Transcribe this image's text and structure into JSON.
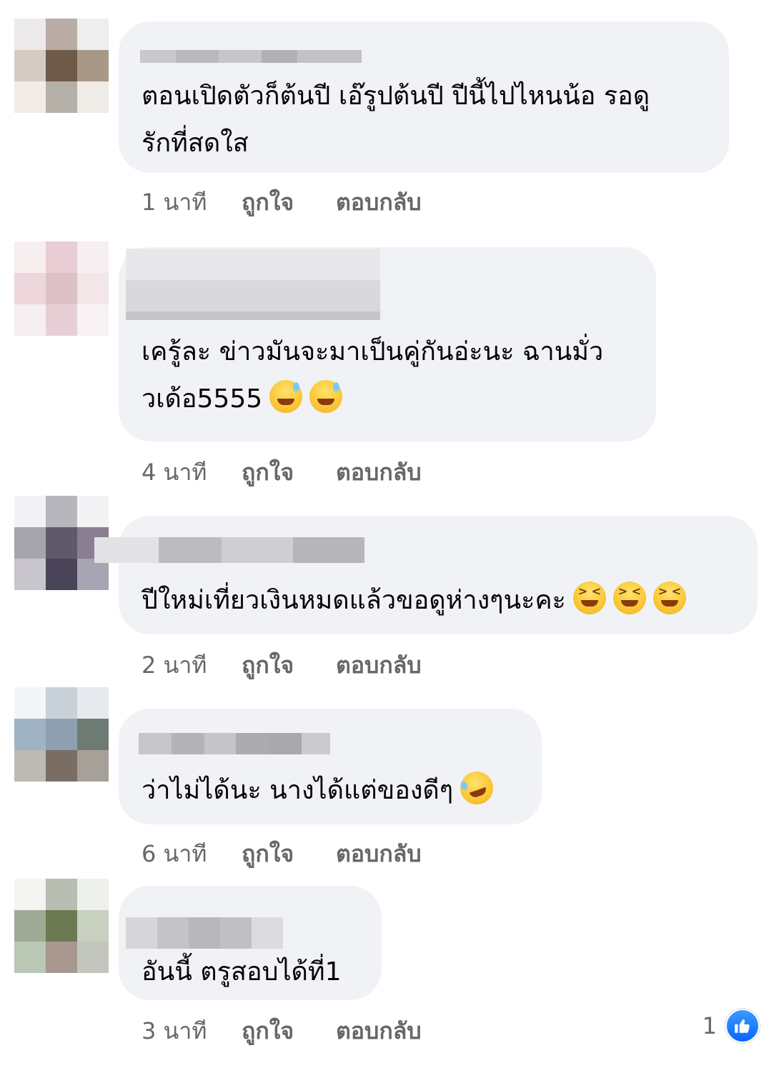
{
  "colors": {
    "bubble_bg": "#f0f2f5",
    "text": "#050505",
    "meta_text": "#65676b",
    "like_blue": "#0866ff"
  },
  "comments": [
    {
      "text": "ตอนเปิดตัวก็ต้นปี เอ๊รูปต้นปี ปีนี้ไปไหนน้อ รอดู\nรักที่สดใส",
      "emojis": [],
      "time": "1 นาที",
      "like_label": "ถูกใจ",
      "reply_label": "ตอบกลับ"
    },
    {
      "text": "เครู้ละ ข่าวมันจะมาเป็นคู่กันอ่ะนะ ฉานมั่ว\nวเด้อ5555",
      "emojis": [
        "grinning-sweat-emoji",
        "grinning-sweat-emoji"
      ],
      "time": "4 นาที",
      "like_label": "ถูกใจ",
      "reply_label": "ตอบกลับ"
    },
    {
      "text": "ปีใหม่เที่ยวเงินหมดแล้วขอดูห่างๆนะคะ",
      "emojis": [
        "squinting-laugh-emoji",
        "squinting-laugh-emoji",
        "squinting-laugh-emoji"
      ],
      "time": "2 นาที",
      "like_label": "ถูกใจ",
      "reply_label": "ตอบกลับ"
    },
    {
      "text": "ว่าไม่ได้นะ นางได้แต่ของดีๆ",
      "emojis": [
        "rolling-laughing-emoji"
      ],
      "time": "6 นาที",
      "like_label": "ถูกใจ",
      "reply_label": "ตอบกลับ"
    },
    {
      "text": "อันนี้ ตรูสอบได้ที่1",
      "emojis": [],
      "time": "3 นาที",
      "like_label": "ถูกใจ",
      "reply_label": "ตอบกลับ",
      "reaction_count": "1",
      "reaction_icon": "thumbs-up-icon"
    }
  ]
}
